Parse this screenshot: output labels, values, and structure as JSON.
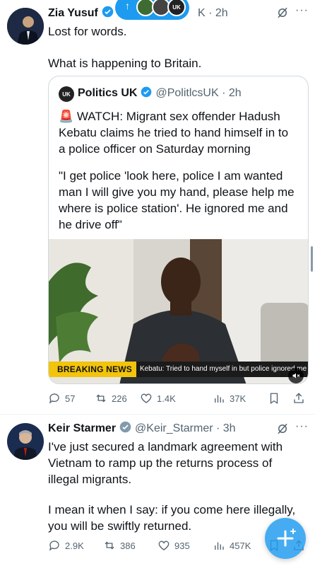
{
  "tweet1": {
    "name": "Zia Yusuf",
    "meta": "K · 2h",
    "text_line1": "Lost for words.",
    "text_line2": "What is happening to Britain.",
    "quoted": {
      "name": "Politics UK",
      "handle_time": "@PolitlcsUK · 2h",
      "avatar_text": "UK",
      "body_line1": "🚨 WATCH: Migrant sex offender Hadush",
      "body_line2": "Kebatu claims he tried to hand himself in to",
      "body_line3": "a police officer on Saturday morning",
      "quote_line1": "\"I get police 'look here, police I am wanted",
      "quote_line2": "man I will give you my hand, please help me",
      "quote_line3": "where is police station'. He ignored me and",
      "quote_line4": "he drive off\"",
      "video_banner": "BREAKING NEWS",
      "video_caption": "Kebatu: Tried to hand myself in but police ignored me"
    },
    "stats": {
      "replies": "57",
      "reposts": "226",
      "likes": "1.4K",
      "views": "37K"
    }
  },
  "tweet2": {
    "name": "Keir Starmer",
    "handle_time": "@Keir_Starmer · 3h",
    "line1": "I've just secured a landmark agreement with",
    "line2": "Vietnam to ramp up the returns process of",
    "line3": "illegal migrants.",
    "line4": "I mean it when I say: if you come here illegally,",
    "line5": "you will be swiftly returned.",
    "stats": {
      "replies": "2.9K",
      "reposts": "386",
      "likes": "935",
      "views": "457K"
    }
  },
  "overlay": {
    "pill_arrow": "↑",
    "pill_avatar_text": "UK"
  },
  "colors": {
    "accent": "#1d9bf0",
    "muted": "#536471",
    "border": "#cfd9de",
    "banner_yellow": "#f2c40c"
  }
}
